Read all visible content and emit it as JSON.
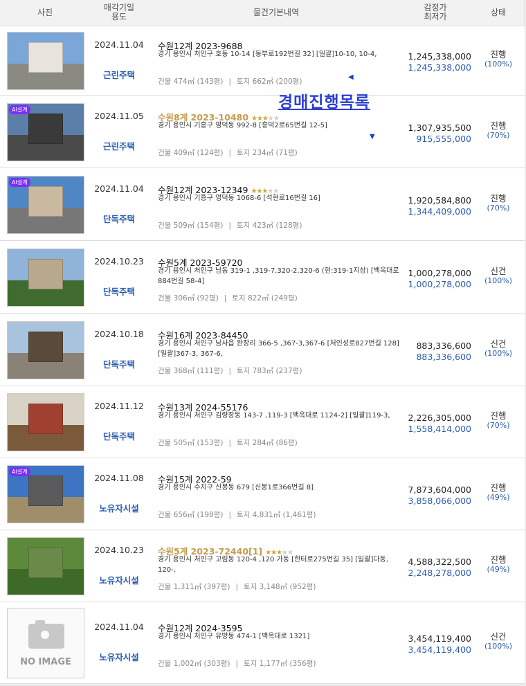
{
  "header": {
    "photo": "사진",
    "date": "매각기일\n용도",
    "info": "물건기본내역",
    "price": "감정가\n최저가",
    "state": "상태"
  },
  "overlay_title": "경매진행목록",
  "rows": [
    {
      "date": "2024.11.04",
      "usage": "근린주택",
      "case": "수원12계 2023-9688",
      "gold": false,
      "stars": 0,
      "ai": false,
      "addr": "경기 용인시 처인구 호동 10-14 [동부로192번길 32] [일괄]10-10, 10-4,",
      "building": "건물 474㎡ (143평)",
      "land": "토지 662㎡ (200평)",
      "appraisal": "1,245,338,000",
      "minimum": "1,245,338,000",
      "state": "진행",
      "pct": "(100%)",
      "colors": {
        "sky": "#7aa7d8",
        "ground": "#8a8a82",
        "bldg": "#e8e4dc"
      }
    },
    {
      "date": "2024.11.05",
      "usage": "근린주택",
      "case": "수원8계 2023-10480",
      "gold": true,
      "stars": 3,
      "ai": true,
      "addr": "경기 용인시 기흥구 영덕동 992-8 [흥덕2로65번길 12-5]",
      "building": "건물 409㎡ (124평)",
      "land": "토지 234㎡ (71평)",
      "appraisal": "1,307,935,500",
      "minimum": "915,555,000",
      "state": "진행",
      "pct": "(70%)",
      "colors": {
        "sky": "#5b7fa8",
        "ground": "#4a4a4a",
        "bldg": "#3a3a3a"
      }
    },
    {
      "date": "2024.11.04",
      "usage": "단독주택",
      "case": "수원12계 2023-12349",
      "gold": false,
      "stars": 3,
      "ai": true,
      "addr": "경기 용인시 기흥구 영덕동 1068-6 [석현로16번길 16]",
      "building": "건물 509㎡ (154평)",
      "land": "토지 423㎡ (128평)",
      "appraisal": "1,920,584,800",
      "minimum": "1,344,409,000",
      "state": "진행",
      "pct": "(70%)",
      "colors": {
        "sky": "#4f86c6",
        "ground": "#777",
        "bldg": "#c9b9a0"
      }
    },
    {
      "date": "2024.10.23",
      "usage": "단독주택",
      "case": "수원5계 2023-59720",
      "gold": false,
      "stars": 0,
      "ai": false,
      "addr": "경기 용인시 처인구 남동 319-1 ,319-7,320-2,320-6 (현:319-1지상) [백옥대로884번길 58-4]",
      "building": "건물 306㎡ (92평)",
      "land": "토지 822㎡ (249평)",
      "appraisal": "1,000,278,000",
      "minimum": "1,000,278,000",
      "state": "신건",
      "pct": "(100%)",
      "colors": {
        "sky": "#8fb3d9",
        "ground": "#3f6b2e",
        "bldg": "#b8a98c"
      }
    },
    {
      "date": "2024.10.18",
      "usage": "단독주택",
      "case": "수원16계 2023-84450",
      "gold": false,
      "stars": 0,
      "ai": false,
      "addr": "경기 용인시 처인구 남사읍 완장리 366-5 ,367-3,367-6 [처인성로827번길 128] [일괄]367-3, 367-6,",
      "building": "건물 368㎡ (111평)",
      "land": "토지 783㎡ (237평)",
      "appraisal": "883,336,600",
      "minimum": "883,336,600",
      "state": "신건",
      "pct": "(100%)",
      "colors": {
        "sky": "#a9c3de",
        "ground": "#8a8276",
        "bldg": "#5a4a3a"
      }
    },
    {
      "date": "2024.11.12",
      "usage": "단독주택",
      "case": "수원13계 2024-55176",
      "gold": false,
      "stars": 0,
      "ai": false,
      "addr": "경기 용인시 처인구 김량장동 143-7 ,119-3 [백옥대로 1124-2] [일괄]119-3,",
      "building": "건물 505㎡ (153평)",
      "land": "토지 284㎡ (86평)",
      "appraisal": "2,226,305,000",
      "minimum": "1,558,414,000",
      "state": "진행",
      "pct": "(70%)",
      "colors": {
        "sky": "#d8d2c4",
        "ground": "#7a5a3a",
        "bldg": "#a04030"
      }
    },
    {
      "date": "2024.11.08",
      "usage": "노유자시설",
      "case": "수원15계 2022-59",
      "gold": false,
      "stars": 0,
      "ai": true,
      "addr": "경기 용인시 수지구 신봉동 679 [신봉1로366번길 8]",
      "building": "건물 656㎡ (198평)",
      "land": "토지 4,831㎡ (1,461평)",
      "appraisal": "7,873,604,000",
      "minimum": "3,858,066,000",
      "state": "진행",
      "pct": "(49%)",
      "colors": {
        "sky": "#3d74c4",
        "ground": "#a08e6a",
        "bldg": "#5a5a5a"
      }
    },
    {
      "date": "2024.10.23",
      "usage": "노유자시설",
      "case": "수원5계 2023-72440[1]",
      "gold": true,
      "stars": 3,
      "ai": false,
      "addr": "경기 용인시 처인구 고림동 120-4 ,120 가동 [한터로275번길 35] [일괄]다동, 120-,",
      "building": "건물 1,311㎡ (397평)",
      "land": "토지 3,148㎡ (952평)",
      "appraisal": "4,588,322,500",
      "minimum": "2,248,278,000",
      "state": "진행",
      "pct": "(49%)",
      "colors": {
        "sky": "#5d8a3a",
        "ground": "#3e6a28",
        "bldg": "#6a8a4a"
      }
    },
    {
      "date": "2024.11.04",
      "usage": "노유자시설",
      "case": "수원12계 2024-3595",
      "gold": false,
      "stars": 0,
      "ai": false,
      "addr": "경기 용인시 처인구 유방동 474-1 [백옥대로 1321]",
      "building": "건물 1,002㎡ (303평)",
      "land": "토지 1,177㎡ (356평)",
      "appraisal": "3,454,119,400",
      "minimum": "3,454,119,400",
      "state": "신건",
      "pct": "(100%)",
      "noimage": "NO IMAGE"
    }
  ],
  "ai_badge": "AI설계",
  "separator": "|"
}
